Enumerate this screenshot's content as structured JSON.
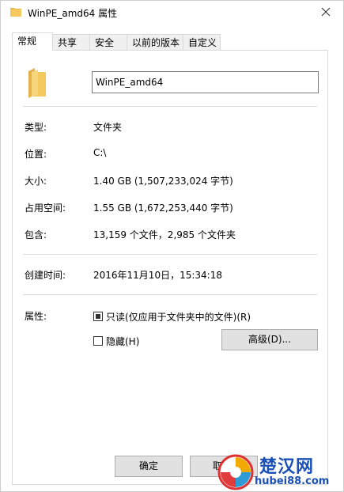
{
  "window": {
    "title": "WinPE_amd64 属性"
  },
  "tabs": [
    {
      "label": "常规",
      "active": true
    },
    {
      "label": "共享",
      "active": false
    },
    {
      "label": "安全",
      "active": false
    },
    {
      "label": "以前的版本",
      "active": false
    },
    {
      "label": "自定义",
      "active": false
    }
  ],
  "general": {
    "name_value": "WinPE_amd64",
    "rows": [
      {
        "label": "类型:",
        "value": "文件夹"
      },
      {
        "label": "位置:",
        "value": "C:\\"
      },
      {
        "label": "大小:",
        "value": "1.40 GB (1,507,233,024 字节)"
      },
      {
        "label": "占用空间:",
        "value": "1.55 GB (1,672,253,440 字节)"
      },
      {
        "label": "包含:",
        "value": "13,159 个文件，2,985 个文件夹"
      }
    ],
    "created": {
      "label": "创建时间:",
      "value": "2016年11月10日，15:34:18"
    },
    "attributes": {
      "label": "属性:",
      "readonly_label": "只读(仅应用于文件夹中的文件)(R)",
      "readonly_state": "indeterminate",
      "hidden_label": "隐藏(H)",
      "hidden_checked": false,
      "advanced_button": "高级(D)..."
    }
  },
  "footer": {
    "ok_button": "确定",
    "cancel_button_partial": "取"
  },
  "watermark": {
    "text_cn": "楚汉网",
    "text_url": "hubei88.com"
  },
  "colors": {
    "folder": "#f4c95d",
    "watermark_blue": "#1a4fb8",
    "button_bg": "#e1e1e1"
  }
}
